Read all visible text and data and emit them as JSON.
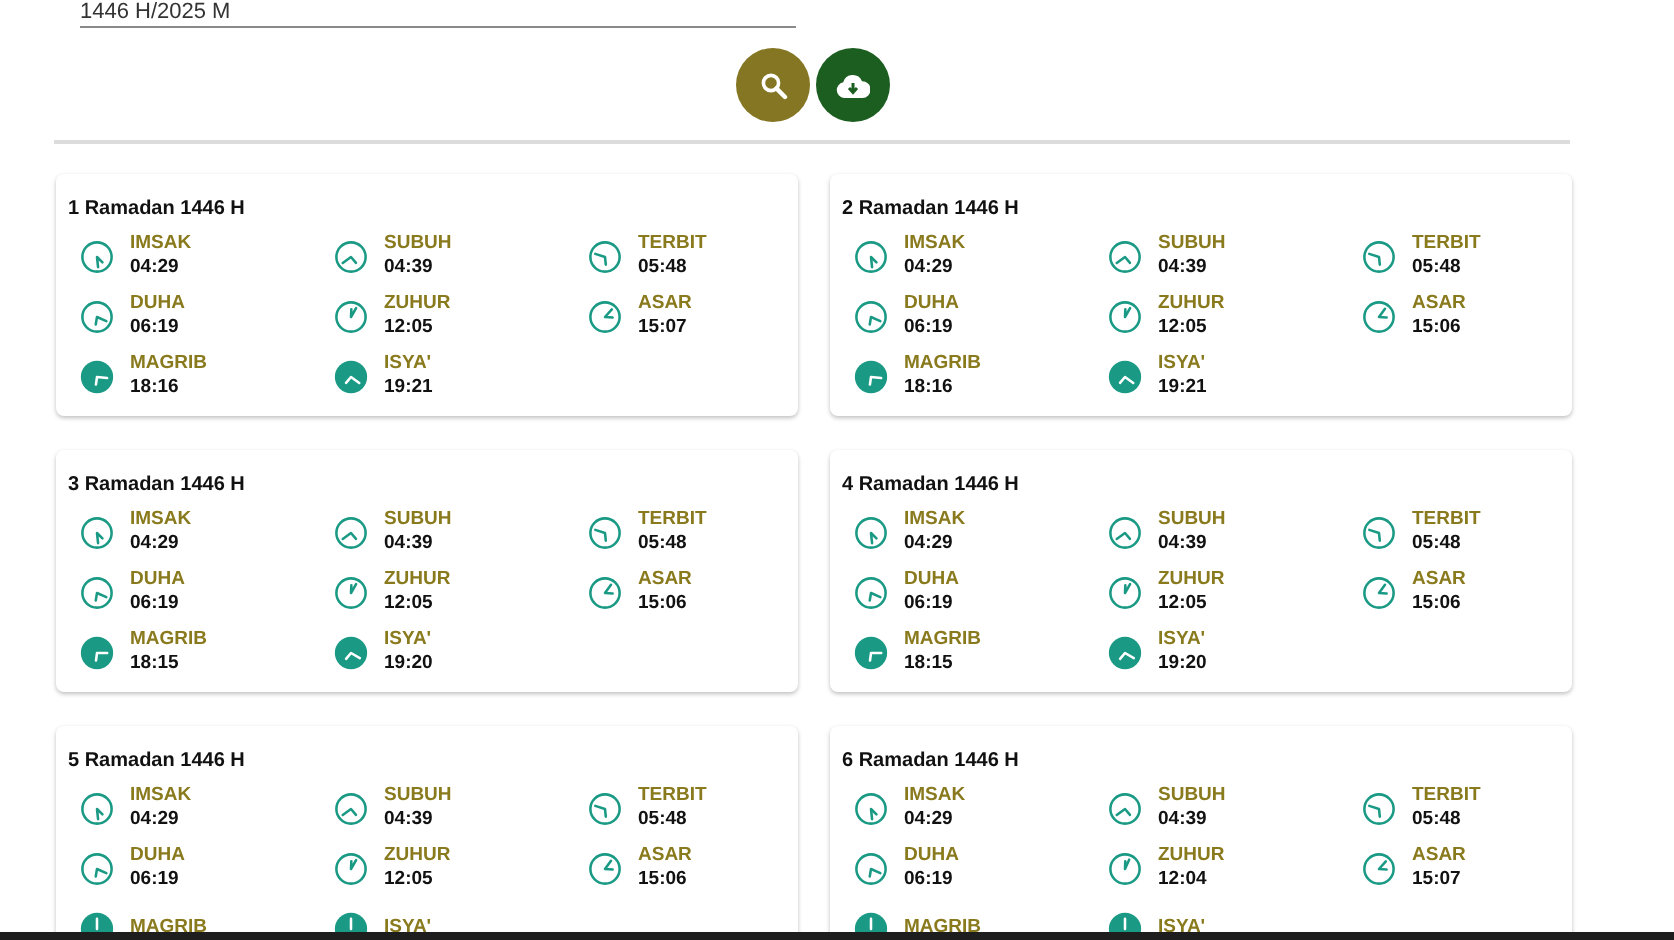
{
  "date_field": {
    "value": "1446 H/2025 M"
  },
  "days": [
    {
      "title": "1 Ramadan 1446 H",
      "times": [
        {
          "label": "IMSAK",
          "time": "04:29",
          "filled": false
        },
        {
          "label": "SUBUH",
          "time": "04:39",
          "filled": false
        },
        {
          "label": "TERBIT",
          "time": "05:48",
          "filled": false
        },
        {
          "label": "DUHA",
          "time": "06:19",
          "filled": false
        },
        {
          "label": "ZUHUR",
          "time": "12:05",
          "filled": false
        },
        {
          "label": "ASAR",
          "time": "15:07",
          "filled": false
        },
        {
          "label": "MAGRIB",
          "time": "18:16",
          "filled": true
        },
        {
          "label": "ISYA'",
          "time": "19:21",
          "filled": true
        }
      ]
    },
    {
      "title": "2 Ramadan 1446 H",
      "times": [
        {
          "label": "IMSAK",
          "time": "04:29",
          "filled": false
        },
        {
          "label": "SUBUH",
          "time": "04:39",
          "filled": false
        },
        {
          "label": "TERBIT",
          "time": "05:48",
          "filled": false
        },
        {
          "label": "DUHA",
          "time": "06:19",
          "filled": false
        },
        {
          "label": "ZUHUR",
          "time": "12:05",
          "filled": false
        },
        {
          "label": "ASAR",
          "time": "15:06",
          "filled": false
        },
        {
          "label": "MAGRIB",
          "time": "18:16",
          "filled": true
        },
        {
          "label": "ISYA'",
          "time": "19:21",
          "filled": true
        }
      ]
    },
    {
      "title": "3 Ramadan 1446 H",
      "times": [
        {
          "label": "IMSAK",
          "time": "04:29",
          "filled": false
        },
        {
          "label": "SUBUH",
          "time": "04:39",
          "filled": false
        },
        {
          "label": "TERBIT",
          "time": "05:48",
          "filled": false
        },
        {
          "label": "DUHA",
          "time": "06:19",
          "filled": false
        },
        {
          "label": "ZUHUR",
          "time": "12:05",
          "filled": false
        },
        {
          "label": "ASAR",
          "time": "15:06",
          "filled": false
        },
        {
          "label": "MAGRIB",
          "time": "18:15",
          "filled": true
        },
        {
          "label": "ISYA'",
          "time": "19:20",
          "filled": true
        }
      ]
    },
    {
      "title": "4 Ramadan 1446 H",
      "times": [
        {
          "label": "IMSAK",
          "time": "04:29",
          "filled": false
        },
        {
          "label": "SUBUH",
          "time": "04:39",
          "filled": false
        },
        {
          "label": "TERBIT",
          "time": "05:48",
          "filled": false
        },
        {
          "label": "DUHA",
          "time": "06:19",
          "filled": false
        },
        {
          "label": "ZUHUR",
          "time": "12:05",
          "filled": false
        },
        {
          "label": "ASAR",
          "time": "15:06",
          "filled": false
        },
        {
          "label": "MAGRIB",
          "time": "18:15",
          "filled": true
        },
        {
          "label": "ISYA'",
          "time": "19:20",
          "filled": true
        }
      ]
    },
    {
      "title": "5 Ramadan 1446 H",
      "times": [
        {
          "label": "IMSAK",
          "time": "04:29",
          "filled": false
        },
        {
          "label": "SUBUH",
          "time": "04:39",
          "filled": false
        },
        {
          "label": "TERBIT",
          "time": "05:48",
          "filled": false
        },
        {
          "label": "DUHA",
          "time": "06:19",
          "filled": false
        },
        {
          "label": "ZUHUR",
          "time": "12:05",
          "filled": false
        },
        {
          "label": "ASAR",
          "time": "15:06",
          "filled": false
        },
        {
          "label": "MAGRIB",
          "filled": true
        },
        {
          "label": "ISYA'",
          "filled": true
        }
      ]
    },
    {
      "title": "6 Ramadan 1446 H",
      "times": [
        {
          "label": "IMSAK",
          "time": "04:29",
          "filled": false
        },
        {
          "label": "SUBUH",
          "time": "04:39",
          "filled": false
        },
        {
          "label": "TERBIT",
          "time": "05:48",
          "filled": false
        },
        {
          "label": "DUHA",
          "time": "06:19",
          "filled": false
        },
        {
          "label": "ZUHUR",
          "time": "12:04",
          "filled": false
        },
        {
          "label": "ASAR",
          "time": "15:07",
          "filled": false
        },
        {
          "label": "MAGRIB",
          "filled": true
        },
        {
          "label": "ISYA'",
          "filled": true
        }
      ]
    }
  ]
}
